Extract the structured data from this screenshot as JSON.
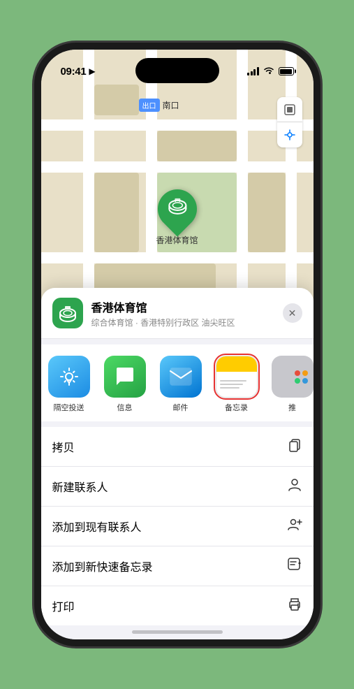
{
  "status_bar": {
    "time": "09:41",
    "location_arrow": "▶"
  },
  "map": {
    "label_tag": "出口",
    "label_text": "南口",
    "stadium_name": "香港体育馆",
    "map_control_layer": "⊞",
    "map_control_location": "◎"
  },
  "location_card": {
    "name": "香港体育馆",
    "subtitle": "综合体育馆 · 香港特别行政区 油尖旺区",
    "close_label": "×"
  },
  "share_row": {
    "items": [
      {
        "id": "airdrop",
        "label": "隔空投送",
        "icon": "📡"
      },
      {
        "id": "message",
        "label": "信息",
        "icon": "💬"
      },
      {
        "id": "mail",
        "label": "邮件",
        "icon": "✉️"
      },
      {
        "id": "notes",
        "label": "备忘录",
        "icon": "notes"
      },
      {
        "id": "more",
        "label": "推",
        "icon": "more"
      }
    ]
  },
  "action_list": {
    "items": [
      {
        "label": "拷贝",
        "icon": "copy"
      },
      {
        "label": "新建联系人",
        "icon": "person"
      },
      {
        "label": "添加到现有联系人",
        "icon": "person-add"
      },
      {
        "label": "添加到新快速备忘录",
        "icon": "quick-note"
      },
      {
        "label": "打印",
        "icon": "print"
      }
    ]
  }
}
